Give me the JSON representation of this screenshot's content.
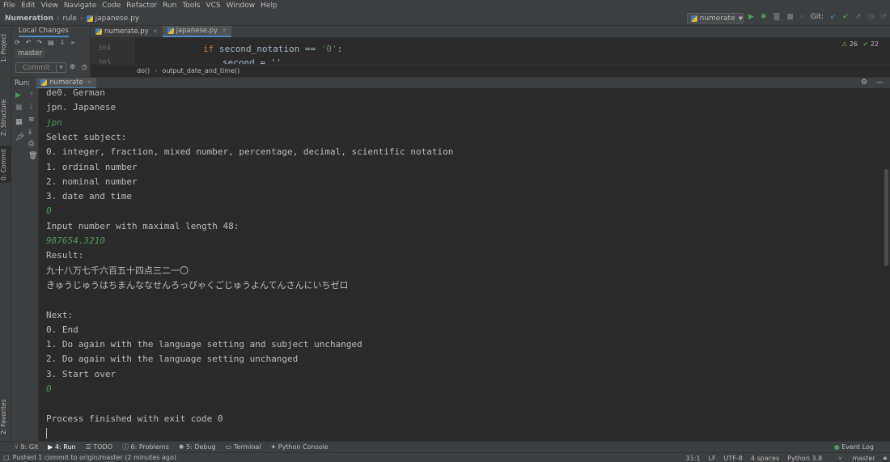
{
  "menu": [
    "File",
    "Edit",
    "View",
    "Navigate",
    "Code",
    "Refactor",
    "Run",
    "Tools",
    "VCS",
    "Window",
    "Help"
  ],
  "nav": {
    "project": "Numeration",
    "folder": "rule",
    "file": "japanese.py",
    "run_config": "numerate",
    "git_label": "Git:"
  },
  "left_tabs": [
    "1: Project",
    "Z: Structure",
    "0: Commit",
    "2: Favorites"
  ],
  "commit_panel": {
    "tab": "Local Changes",
    "branch": "master",
    "commit_button": "Commit"
  },
  "editor": {
    "tabs": [
      {
        "label": "numerate.py"
      },
      {
        "label": "japanese.py"
      }
    ],
    "lines": [
      {
        "num": "304"
      },
      {
        "num": "305"
      }
    ],
    "code_keyword": "if",
    "code_rest": " second_notation == ",
    "code_string": "'0'",
    "code_colon": ":",
    "code_partial": "second = ''",
    "inspection_warnings": "26",
    "inspection_ok": "22",
    "breadcrumb": [
      "do()",
      "output_date_and_time()"
    ]
  },
  "run_panel": {
    "label": "Run:",
    "tab": "numerate"
  },
  "console": {
    "lines": [
      {
        "text": "de0. German",
        "input": false
      },
      {
        "text": "jpn. Japanese",
        "input": false
      },
      {
        "text": "jpn",
        "input": true
      },
      {
        "text": "Select subject:",
        "input": false
      },
      {
        "text": "0. integer, fraction, mixed number, percentage, decimal, scientific notation",
        "input": false
      },
      {
        "text": "1. ordinal number",
        "input": false
      },
      {
        "text": "2. nominal number",
        "input": false
      },
      {
        "text": "3. date and time",
        "input": false
      },
      {
        "text": "0",
        "input": true
      },
      {
        "text": "Input number with maximal length 48:",
        "input": false
      },
      {
        "text": "987654.3210",
        "input": true
      },
      {
        "text": "Result:",
        "input": false
      },
      {
        "text": "九十八万七千六百五十四点三二一〇",
        "input": false
      },
      {
        "text": "きゅうじゅうはちまんななせんろっぴゃくごじゅうよんてんさんにいちゼロ",
        "input": false
      },
      {
        "text": "",
        "input": false
      },
      {
        "text": "Next:",
        "input": false
      },
      {
        "text": "0. End",
        "input": false
      },
      {
        "text": "1. Do again with the language setting and subject unchanged",
        "input": false
      },
      {
        "text": "2. Do again with the language setting unchanged",
        "input": false
      },
      {
        "text": "3. Start over",
        "input": false
      },
      {
        "text": "0",
        "input": true
      },
      {
        "text": "",
        "input": false
      },
      {
        "text": "Process finished with exit code 0",
        "input": false
      }
    ]
  },
  "tool_windows": [
    "9: Git",
    "4: Run",
    "TODO",
    "6: Problems",
    "5: Debug",
    "Terminal",
    "Python Console"
  ],
  "event_log": "Event Log",
  "status": {
    "message": "Pushed 1 commit to origin/master (2 minutes ago)",
    "position": "31:1",
    "line_sep": "LF",
    "encoding": "UTF-8",
    "indent": "4 spaces",
    "interpreter": "Python 3.8",
    "branch": "master"
  }
}
